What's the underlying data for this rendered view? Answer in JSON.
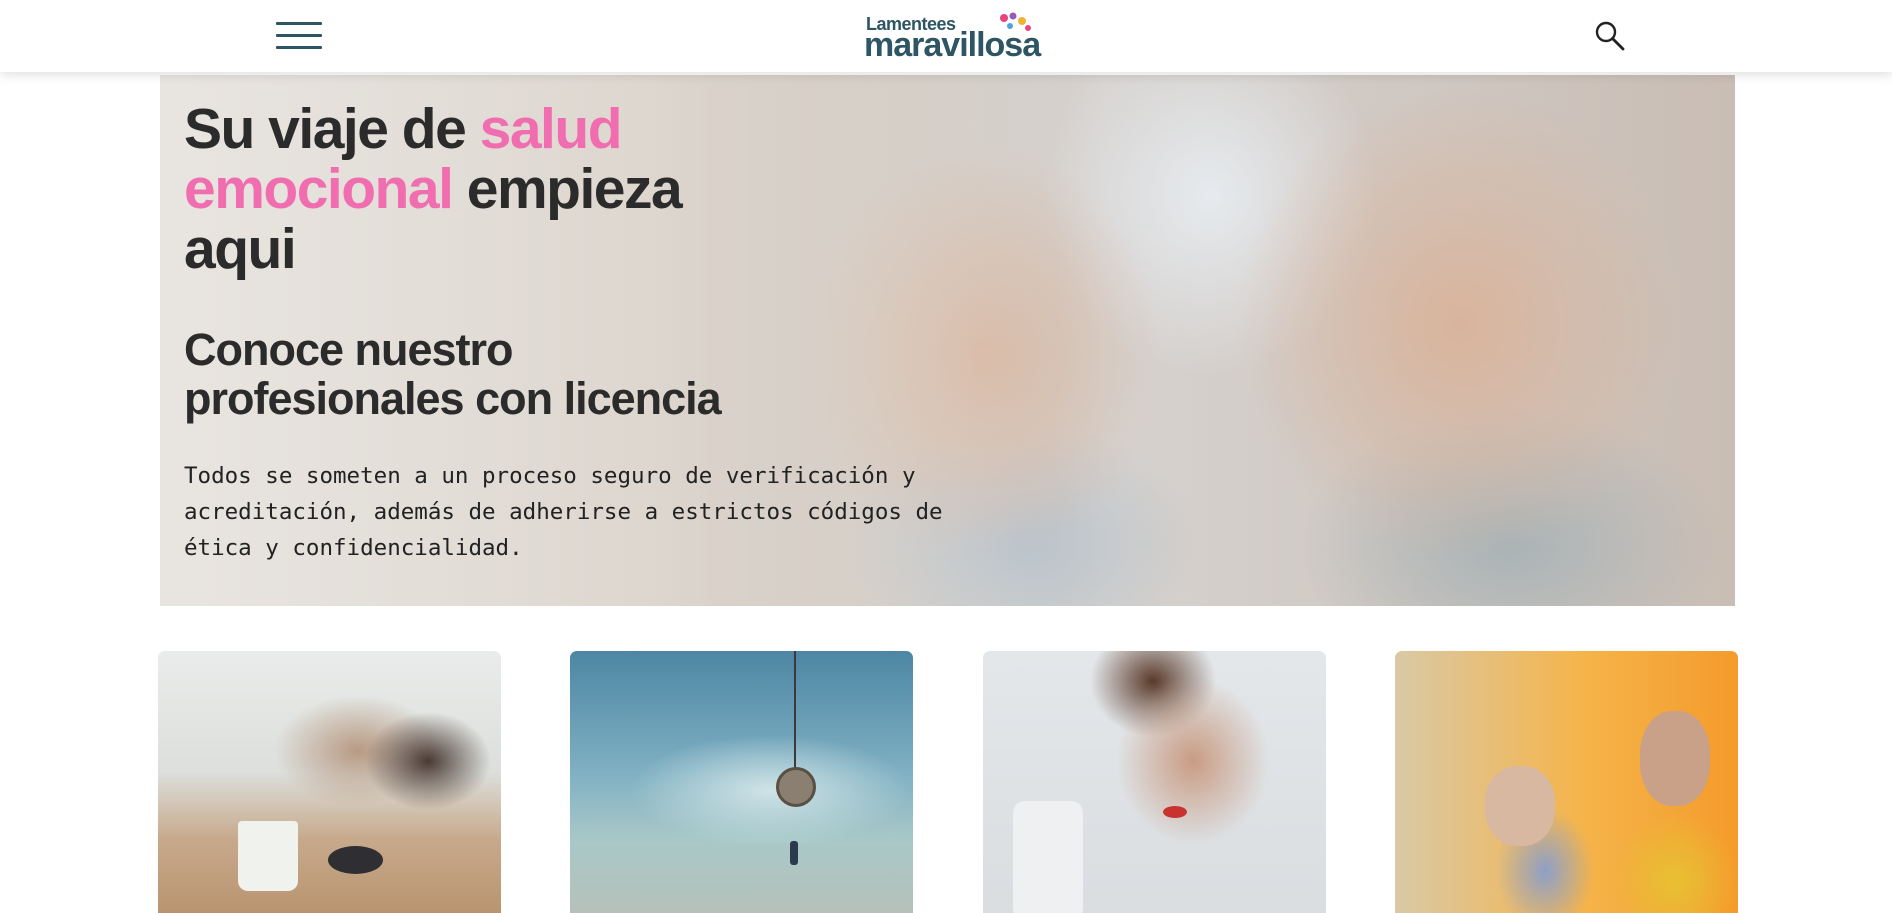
{
  "header": {
    "menu_icon": "hamburger-menu-icon",
    "logo": {
      "top_text": "Lamentees",
      "main_text": "maravillosa"
    },
    "search_icon": "search-icon",
    "colors": {
      "logo": "#2e5563",
      "dots": [
        "#e8457a",
        "#f2b233",
        "#4fa3d9",
        "#9b59b6",
        "#e8457a"
      ]
    }
  },
  "hero": {
    "title_part1": "Su viaje de ",
    "title_highlight": "salud emocional",
    "title_part2": " empieza aqui",
    "subtitle": "Conoce nuestro profesionales con licencia",
    "body": "Todos se someten a un proceso seguro de verificación y acreditación, además de adherirse a estrictos códigos de ética y confidencialidad.",
    "colors": {
      "highlight": "#f06eb0",
      "text": "#2b2b2b"
    }
  },
  "cards": [
    {
      "image": "woman-asleep-at-desk-photo"
    },
    {
      "image": "pendulum-clock-sky-photo"
    },
    {
      "image": "woman-with-phone-photo"
    },
    {
      "image": "mother-and-daughter-photo"
    }
  ]
}
